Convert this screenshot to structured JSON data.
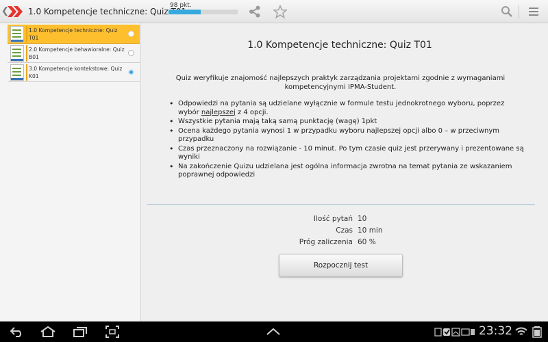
{
  "app": {
    "title": "1.0 Kompetencje techniczne: Quiz T01",
    "score_label": "98 pkt.",
    "score_progress": 0.47
  },
  "sidebar": {
    "items": [
      {
        "label": "1.0 Kompetencje techniczne: Quiz T01",
        "active": true
      },
      {
        "label": "2.0 Kompetencje behawioralne: Quiz B01",
        "active": false
      },
      {
        "label": "3.0 Kompetencje kontekstowe: Quiz K01",
        "active": false
      }
    ]
  },
  "main": {
    "title": "1.0 Kompetencje techniczne: Quiz T01",
    "intro": "Quiz weryfikuje znajomość najlepszych praktyk zarządzania projektami zgodnie z wymaganiami kompetencyjnymi IPMA-Student.",
    "rules": {
      "r1_a": "Odpowiedzi na pytania są udzielane wyłącznie w formule testu jednokrotnego wyboru, poprzez wybór ",
      "r1_u": "najlepszej",
      "r1_b": " z 4 opcji.",
      "r2": "Wszystkie pytania mają taką samą punktację (wagę) 1pkt",
      "r3": "Ocena każdego pytania wynosi 1 w przypadku wyboru najlepszej opcji albo 0 – w przeciwnym przypadku",
      "r4": "Czas przeznaczony na rozwiązanie - 10 minut. Po tym czasie quiz jest przerywany i prezentowane są wyniki",
      "r5": "Na zakończenie Quizu udzielana jest ogólna informacja zwrotna na temat pytania ze wskazaniem poprawnej odpowiedzi"
    },
    "info": [
      {
        "label": "Ilość pytań",
        "value": "10"
      },
      {
        "label": "Czas",
        "value": "10 min"
      },
      {
        "label": "Próg zaliczenia",
        "value": "60 %"
      }
    ],
    "start_button": "Rozpocznij test"
  },
  "system": {
    "clock": "23:32"
  },
  "colors": {
    "accent": "#fdbf2d",
    "progress": "#35a9dd",
    "logo": "#e8322d"
  },
  "icons": [
    "back-icon",
    "app-logo-icon",
    "share-icon",
    "star-icon",
    "search-icon",
    "menu-icon",
    "nav-back-icon",
    "home-icon",
    "recent-apps-icon",
    "screenshot-icon",
    "nav-up-icon",
    "wifi-icon",
    "battery-icon"
  ]
}
